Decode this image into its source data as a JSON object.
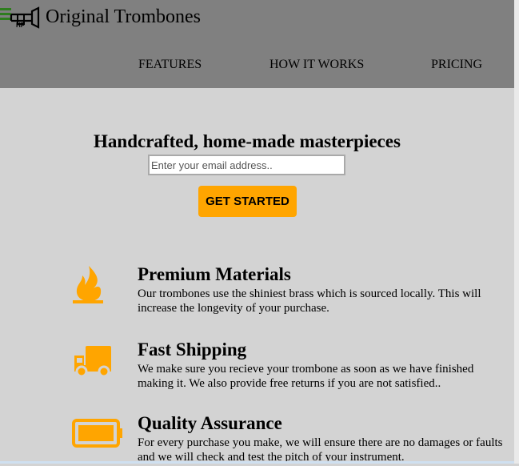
{
  "header": {
    "brand": "Original Trombones",
    "logo_icon": "trombone-icon",
    "menu_icon": "hamburger-icon",
    "nav": [
      "FEATURES",
      "HOW IT WORKS",
      "PRICING"
    ]
  },
  "hero": {
    "title": "Handcrafted, home-made masterpieces",
    "email_placeholder": "Enter your email address..",
    "cta_label": "GET STARTED"
  },
  "features": [
    {
      "icon": "fire-icon",
      "title": "Premium Materials",
      "text": "Our trombones use the shiniest brass which is sourced locally. This will increase the longevity of your purchase."
    },
    {
      "icon": "truck-icon",
      "title": "Fast Shipping",
      "text": "We make sure you recieve your trombone as soon as we have finished making it. We also provide free returns if you are not satisfied.."
    },
    {
      "icon": "battery-icon",
      "title": "Quality Assurance",
      "text": "For every purchase you make, we will ensure there are no damages or faults and we will check and test the pitch of your instrument."
    }
  ],
  "colors": {
    "header_bg": "#808080",
    "page_bg": "#d3d3d3",
    "accent": "#ffa500"
  }
}
